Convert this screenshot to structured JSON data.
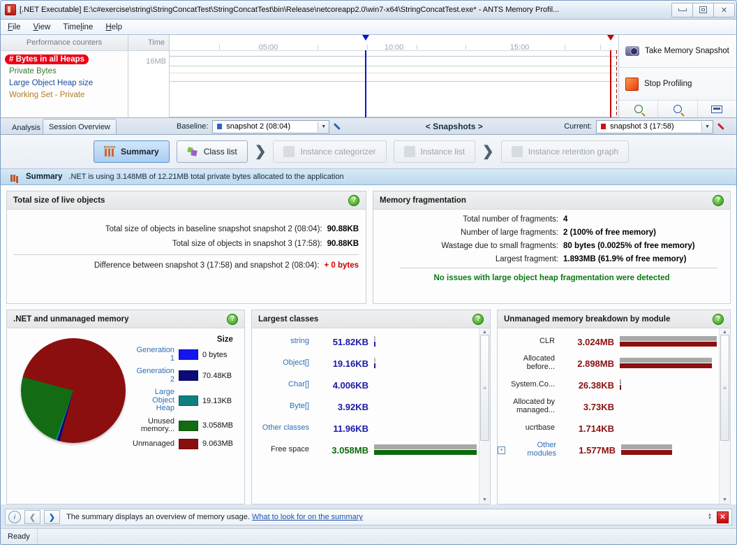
{
  "window": {
    "title": "[.NET Executable] E:\\c#exercise\\string\\StringConcatTest\\StringConcatTest\\bin\\Release\\netcoreapp2.0\\win7-x64\\StringConcatTest.exe* - ANTS Memory Profil...",
    "minimize_label": "Minimize",
    "maximize_label": "Maximize",
    "close_label": "✕"
  },
  "menu": {
    "items": [
      "File",
      "View",
      "Timeline",
      "Help"
    ]
  },
  "counters": {
    "header": "Performance counters",
    "items": [
      {
        "label": "# Bytes in all Heaps",
        "selected": true,
        "color": "#ffffff"
      },
      {
        "label": "Private Bytes",
        "selected": false,
        "color": "#3a7a30"
      },
      {
        "label": "Large Object Heap size",
        "selected": false,
        "color": "#1b4ea0"
      },
      {
        "label": "Working Set - Private",
        "selected": false,
        "color": "#b37b22"
      }
    ]
  },
  "timeline": {
    "time_header": "Time",
    "y_label": "16MB",
    "ticks": [
      "05:00",
      "10:00",
      "15:00"
    ],
    "baseline_marker_color": "#0a12d0",
    "current_marker_color": "#c80000"
  },
  "snapshot_panel": {
    "take_snapshot": "Take Memory Snapshot",
    "stop_profiling": "Stop Profiling",
    "zoom_in": "zoom-in",
    "zoom_out": "zoom-out",
    "zoom_fit": "zoom-fit"
  },
  "tabs": [
    {
      "label": "Analysis",
      "active": false
    },
    {
      "label": "Session Overview",
      "active": true
    }
  ],
  "snapshot_bar": {
    "baseline_label": "Baseline:",
    "baseline_value": "snapshot 2 (08:04)",
    "baseline_color": "#2a63c8",
    "middle_label": "< Snapshots >",
    "current_label": "Current:",
    "current_value": "snapshot 3 (17:58)",
    "current_color": "#cc1111"
  },
  "steps": [
    {
      "label": "Summary",
      "state": "active",
      "icon": "bar-chart-icon"
    },
    {
      "label": "Class list",
      "state": "enabled",
      "icon": "class-list-icon"
    },
    {
      "label": "Instance categorizer",
      "state": "disabled",
      "icon": "categorizer-icon"
    },
    {
      "label": "Instance list",
      "state": "disabled",
      "icon": "instance-list-icon"
    },
    {
      "label": "Instance retention graph",
      "state": "disabled",
      "icon": "retention-graph-icon"
    }
  ],
  "summary_header": {
    "title": "Summary",
    "subtitle": ".NET is using 3.148MB of 12.21MB total private bytes allocated to the application"
  },
  "live_objects": {
    "title": "Total size of live objects",
    "rows": [
      {
        "label": "Total size of objects in baseline snapshot snapshot 2 (08:04):",
        "value": "90.88KB"
      },
      {
        "label": "Total size of objects in snapshot 3 (17:58):",
        "value": "90.88KB"
      }
    ],
    "difference_label": "Difference between snapshot 3 (17:58) and snapshot 2 (08:04):",
    "difference_value": "+ 0 bytes"
  },
  "fragmentation": {
    "title": "Memory fragmentation",
    "rows": [
      {
        "label": "Total number of fragments:",
        "value": "4"
      },
      {
        "label": "Number of large fragments:",
        "value": "2 (100% of free memory)"
      },
      {
        "label": "Wastage due to small fragments:",
        "value": "80 bytes (0.0025% of free memory)"
      },
      {
        "label": "Largest fragment:",
        "value": "1.893MB (61.9% of free memory)"
      }
    ],
    "status": "No issues with large object heap fragmentation were detected"
  },
  "memory_pie": {
    "title": ".NET and unmanaged memory",
    "size_header": "Size",
    "legend": [
      {
        "name": "Generation 1",
        "value": "0 bytes",
        "color": "#1515ee"
      },
      {
        "name": "Generation 2",
        "value": "70.48KB",
        "color": "#0b0b7a"
      },
      {
        "name": "Large Object Heap",
        "value": "19.13KB",
        "color": "#0e8080"
      },
      {
        "name": "Unused memory...",
        "value": "3.058MB",
        "color": "#136b13"
      },
      {
        "name": "Unmanaged",
        "value": "9.063MB",
        "color": "#8b0f0f"
      }
    ]
  },
  "largest_classes": {
    "title": "Largest classes",
    "rows": [
      {
        "name": "string",
        "value": "51.82KB",
        "bar_pct": 1.6,
        "bar_color": "#1a1aa8",
        "link": true
      },
      {
        "name": "Object[]",
        "value": "19.16KB",
        "bar_pct": 1.1,
        "bar_color": "#1a1aa8",
        "link": true
      },
      {
        "name": "Char[]",
        "value": "4.006KB",
        "bar_pct": 0,
        "bar_color": "#1a1aa8",
        "link": true
      },
      {
        "name": "Byte[]",
        "value": "3.92KB",
        "bar_pct": 0,
        "bar_color": "#1a1aa8",
        "link": true
      },
      {
        "name": "Other classes",
        "value": "11.96KB",
        "bar_pct": 0,
        "bar_color": "#1a1aa8",
        "link": true
      },
      {
        "name": "Free space",
        "value": "3.058MB",
        "bar_pct": 100,
        "bar_color": "#0b6b0b",
        "link": false
      }
    ],
    "value_color": "#1a1aa8",
    "free_value_color": "#0b6b0b"
  },
  "unmanaged_modules": {
    "title": "Unmanaged memory breakdown by module",
    "rows": [
      {
        "name": "CLR",
        "value": "3.024MB",
        "bar_pct": 100,
        "expander": false,
        "link": false
      },
      {
        "name": "Allocated before...",
        "value": "2.898MB",
        "bar_pct": 95,
        "expander": false,
        "link": false
      },
      {
        "name": "System.Co...",
        "value": "26.38KB",
        "bar_pct": 1.2,
        "expander": false,
        "link": false
      },
      {
        "name": "Allocated by managed...",
        "value": "3.73KB",
        "bar_pct": 0,
        "expander": false,
        "link": false
      },
      {
        "name": "ucrtbase",
        "value": "1.714KB",
        "bar_pct": 0,
        "expander": false,
        "link": false
      },
      {
        "name": "Other modules",
        "value": "1.577MB",
        "bar_pct": 52,
        "expander": true,
        "link": true
      }
    ],
    "value_color": "#8b1111"
  },
  "tip_bar": {
    "text": "The summary displays an overview of memory usage.",
    "link": "What to look for on the summary",
    "back": "❮",
    "forward": "❯",
    "close": "✕"
  },
  "status_bar": {
    "text": "Ready"
  }
}
